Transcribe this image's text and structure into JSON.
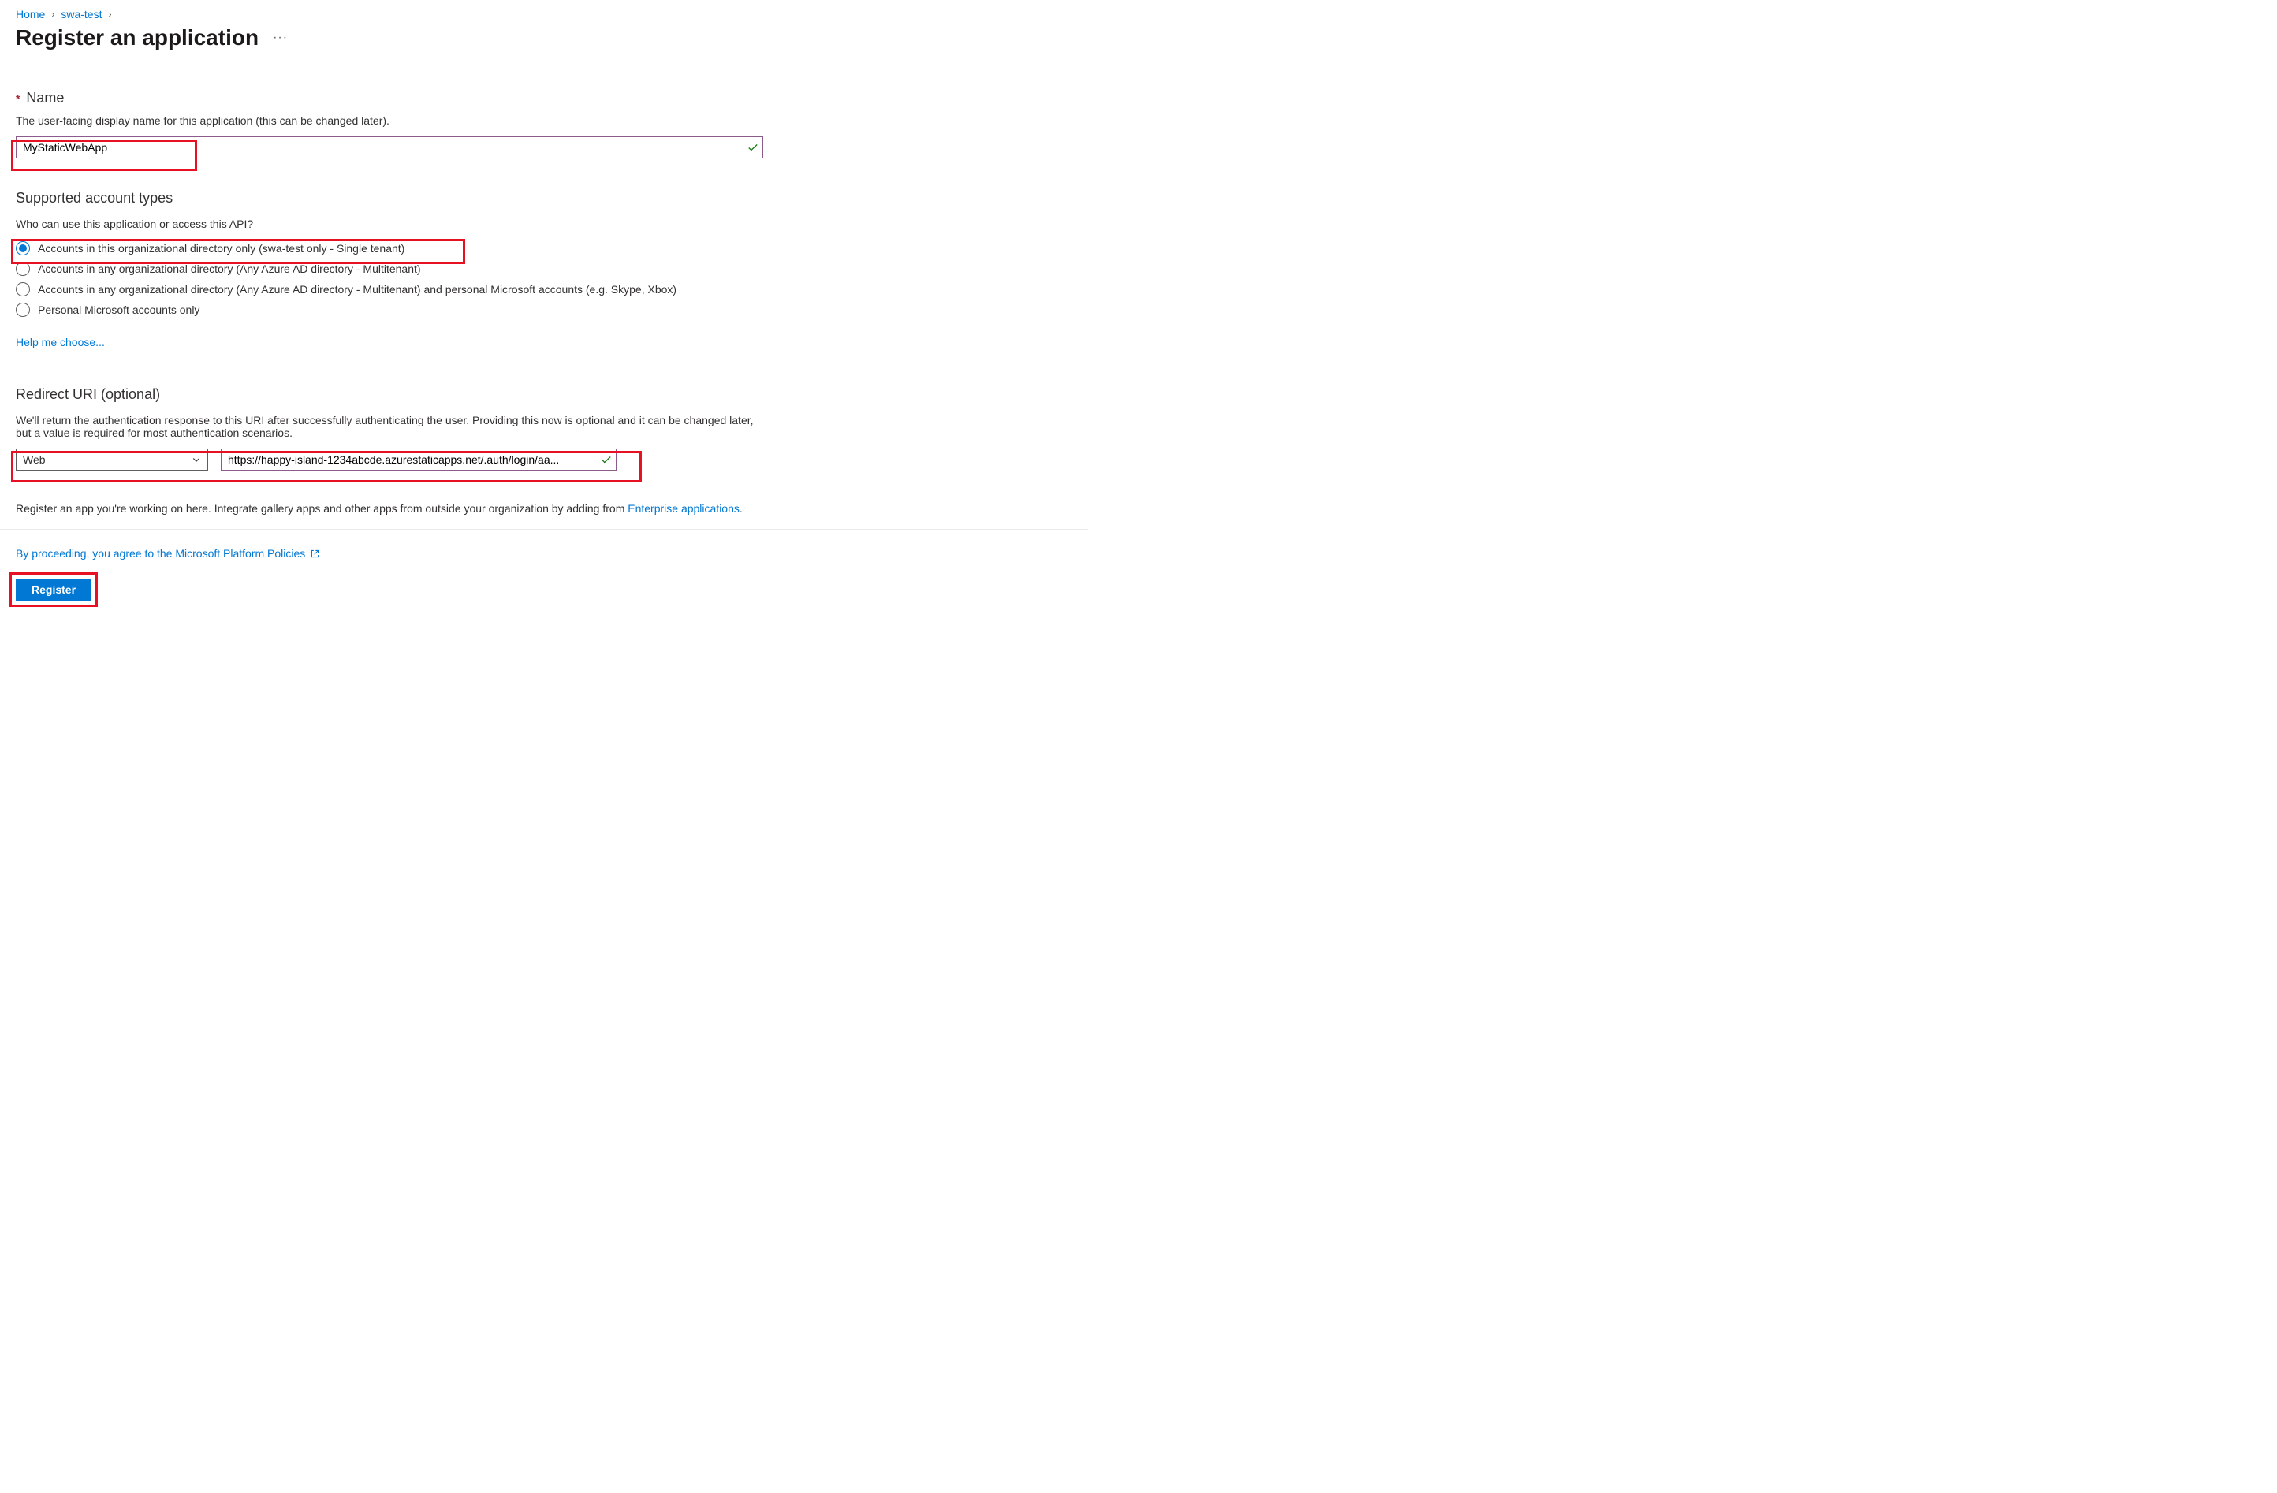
{
  "breadcrumb": {
    "home": "Home",
    "item2": "swa-test"
  },
  "title": "Register an application",
  "nameSection": {
    "label": "Name",
    "desc": "The user-facing display name for this application (this can be changed later).",
    "value": "MyStaticWebApp"
  },
  "accountTypes": {
    "heading": "Supported account types",
    "question": "Who can use this application or access this API?",
    "options": {
      "o1": "Accounts in this organizational directory only (swa-test only - Single tenant)",
      "o2": "Accounts in any organizational directory (Any Azure AD directory - Multitenant)",
      "o3": "Accounts in any organizational directory (Any Azure AD directory - Multitenant) and personal Microsoft accounts (e.g. Skype, Xbox)",
      "o4": "Personal Microsoft accounts only"
    },
    "helpLink": "Help me choose..."
  },
  "redirect": {
    "heading": "Redirect URI (optional)",
    "desc": "We'll return the authentication response to this URI after successfully authenticating the user. Providing this now is optional and it can be changed later, but a value is required for most authentication scenarios.",
    "platform": "Web",
    "uri": "https://happy-island-1234abcde.azurestaticapps.net/.auth/login/aa..."
  },
  "footer": {
    "text1": "Register an app you're working on here. Integrate gallery apps and other apps from outside your organization by adding from ",
    "enterpriseLink": "Enterprise applications",
    "policyText": "By proceeding, you agree to the Microsoft Platform Policies",
    "registerLabel": "Register"
  }
}
